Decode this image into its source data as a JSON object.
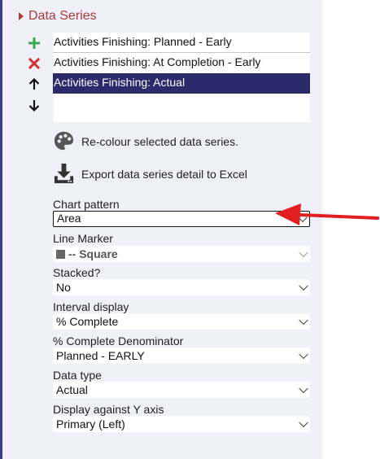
{
  "section": {
    "title": "Data Series"
  },
  "series_list": [
    {
      "label": "Activities Finishing: Planned - Early"
    },
    {
      "label": "Activities Finishing: At Completion - Early"
    },
    {
      "label": "Activities Finishing: Actual",
      "selected": true
    }
  ],
  "icons": {
    "add": "plus-icon",
    "remove": "x-icon",
    "up": "arrow-up-icon",
    "down": "arrow-down-icon",
    "palette": "palette-icon",
    "export": "download-icon",
    "arrow": "red-arrow-annotation"
  },
  "actions": {
    "recolour": "Re-colour selected data series.",
    "export": "Export data series detail to Excel"
  },
  "fields": {
    "chart_pattern": {
      "label": "Chart pattern",
      "value": "Area"
    },
    "line_marker": {
      "label": "Line Marker",
      "value": "-- Square"
    },
    "stacked": {
      "label": "Stacked?",
      "value": "No"
    },
    "interval_display": {
      "label": "Interval display",
      "value": "% Complete"
    },
    "complete_denominator": {
      "label": "% Complete Denominator",
      "value": "Planned - EARLY"
    },
    "data_type": {
      "label": "Data type",
      "value": "Actual"
    },
    "y_axis": {
      "label": "Display against Y axis",
      "value": "Primary (Left)"
    }
  },
  "colors": {
    "header": "#b03a3a",
    "selected_bg": "#2b2b6b",
    "panel_bg": "#f0f0f8",
    "add_icon": "#3aa84a",
    "remove_icon": "#d32f2f",
    "annotation": "#e0201e"
  }
}
